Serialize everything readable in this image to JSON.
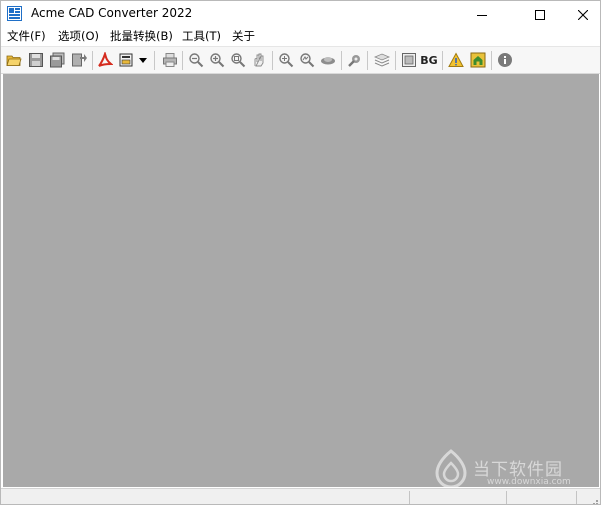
{
  "window": {
    "title": "Acme CAD Converter 2022",
    "controls": {
      "minimize": "minimize-icon",
      "maximize": "maximize-icon",
      "close": "close-icon"
    }
  },
  "menu": [
    {
      "label": "文件(F)"
    },
    {
      "label": "选项(O)"
    },
    {
      "label": "批量转换(B)"
    },
    {
      "label": "工具(T)"
    },
    {
      "label": "关于"
    }
  ],
  "toolbar": {
    "bg_label": "BG",
    "icons": [
      "open-folder-icon",
      "save-icon",
      "save-all-icon",
      "export-icon",
      "acrobat-pdf-icon",
      "batch-convert-icon",
      "dropdown-arrow-icon",
      "print-icon",
      "zoom-out-icon",
      "zoom-in-icon",
      "zoom-extents-icon",
      "pan-icon",
      "zoom-window-icon",
      "zoom-realtime-icon",
      "view-icon",
      "settings-icon",
      "layers-icon",
      "frame-icon",
      "bg-color-icon",
      "warning-icon",
      "home-icon",
      "info-icon"
    ]
  },
  "watermark": {
    "text": "当下软件园",
    "url": "www.downxia.com"
  },
  "colors": {
    "workspace": "#a9a9a9",
    "toolbar": "#f7f7f7",
    "accent_blue": "#1f6fc7"
  }
}
